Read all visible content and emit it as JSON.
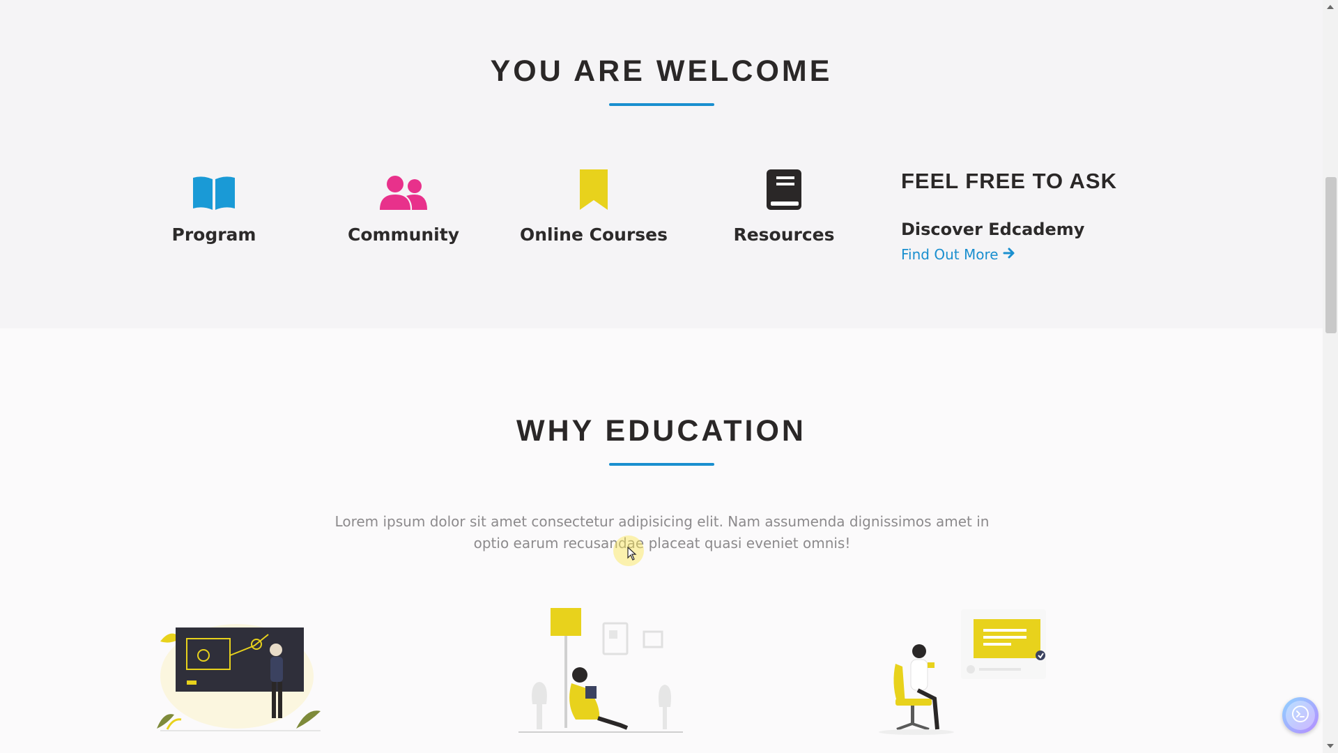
{
  "welcome": {
    "title": "YOU ARE WELCOME",
    "features": [
      {
        "label": "Program",
        "icon": "book-open-icon",
        "color": "#1a9ad6"
      },
      {
        "label": "Community",
        "icon": "users-icon",
        "color": "#e8318b"
      },
      {
        "label": "Online Courses",
        "icon": "bookmark-icon",
        "color": "#e8d21c"
      },
      {
        "label": "Resources",
        "icon": "book-icon",
        "color": "#2a2727"
      }
    ],
    "ask": {
      "title": "FEEL FREE TO ASK",
      "subtitle": "Discover Edcademy",
      "link_label": "Find Out More",
      "link_icon": "arrow-right-icon"
    }
  },
  "why": {
    "title": "WHY EDUCATION",
    "lead": "Lorem ipsum dolor sit amet consectetur adipisicing elit. Nam assumenda dignissimos amet in optio earum recusandae placeat quasi eveniet omnis!",
    "illustrations": [
      "teacher-at-board-illustration",
      "reading-under-lamp-illustration",
      "person-on-chair-with-message-illustration"
    ]
  },
  "colors": {
    "accent": "#1a8fcf",
    "yellow": "#e8d21c",
    "pink": "#e8318b",
    "blue": "#1a9ad6"
  },
  "widgets": {
    "chat_icon": "chat-prompt-icon"
  }
}
